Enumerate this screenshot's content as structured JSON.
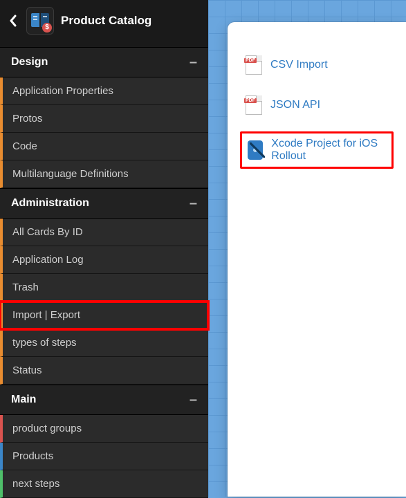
{
  "header": {
    "title": "Product Catalog"
  },
  "sections": [
    {
      "title": "Design",
      "items": [
        {
          "label": "Application Properties",
          "accent": "orange"
        },
        {
          "label": "Protos",
          "accent": "orange"
        },
        {
          "label": "Code",
          "accent": "orange"
        },
        {
          "label": "Multilanguage Definitions",
          "accent": "orange"
        }
      ]
    },
    {
      "title": "Administration",
      "items": [
        {
          "label": "All Cards By ID",
          "accent": "orange"
        },
        {
          "label": "Application Log",
          "accent": "orange"
        },
        {
          "label": "Trash",
          "accent": "orange"
        },
        {
          "label": "Import | Export",
          "accent": "orange",
          "highlight": true
        },
        {
          "label": "types of steps",
          "accent": "orange"
        },
        {
          "label": "Status",
          "accent": "orange"
        }
      ]
    },
    {
      "title": "Main",
      "items": [
        {
          "label": "product groups",
          "accent": "red"
        },
        {
          "label": "Products",
          "accent": "blue"
        },
        {
          "label": "next steps",
          "accent": "green"
        }
      ]
    }
  ],
  "panel": {
    "items": [
      {
        "label": "CSV Import",
        "icon": "pdf"
      },
      {
        "label": "JSON API",
        "icon": "pdf"
      },
      {
        "label": "Xcode Project for iOS Rollout",
        "icon": "xcode",
        "highlight": true
      }
    ]
  }
}
